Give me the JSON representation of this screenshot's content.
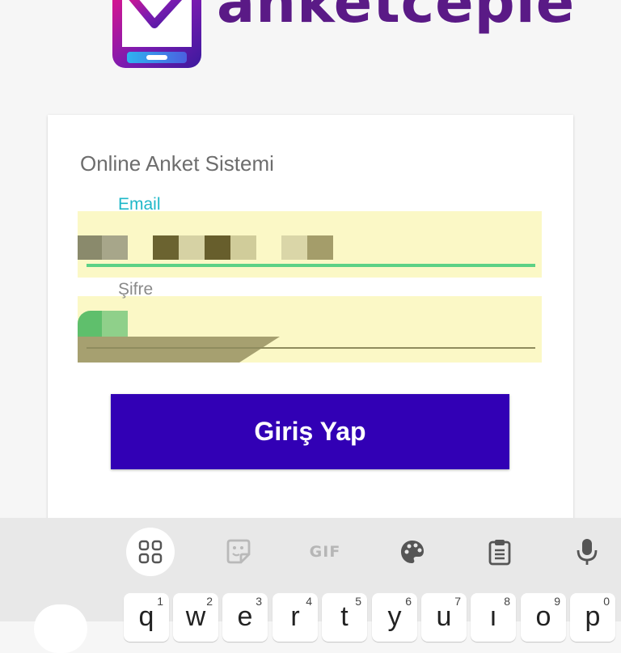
{
  "logo": {
    "text": "anketceple",
    "icon": "phone-check-logo-icon"
  },
  "card": {
    "title": "Online Anket Sistemi",
    "email_label": "Email",
    "password_label": "Şifre",
    "login_button": "Giriş Yap"
  },
  "colors": {
    "primary_button": "#3200b5",
    "email_label": "#1fb8c8",
    "field_highlight": "#fbf8c6",
    "logo_text": "#5a1a86"
  },
  "keyboard": {
    "toolbar": [
      {
        "name": "apps-grid-icon"
      },
      {
        "name": "sticker-icon"
      },
      {
        "name": "gif-icon",
        "label": "GIF"
      },
      {
        "name": "palette-icon"
      },
      {
        "name": "clipboard-icon"
      },
      {
        "name": "microphone-icon"
      }
    ],
    "row1": [
      {
        "ch": "q",
        "num": "1"
      },
      {
        "ch": "w",
        "num": "2"
      },
      {
        "ch": "e",
        "num": "3"
      },
      {
        "ch": "r",
        "num": "4"
      },
      {
        "ch": "t",
        "num": "5"
      },
      {
        "ch": "y",
        "num": "6"
      },
      {
        "ch": "u",
        "num": "7"
      },
      {
        "ch": "ı",
        "num": "8"
      },
      {
        "ch": "o",
        "num": "9"
      },
      {
        "ch": "p",
        "num": "0"
      }
    ]
  }
}
